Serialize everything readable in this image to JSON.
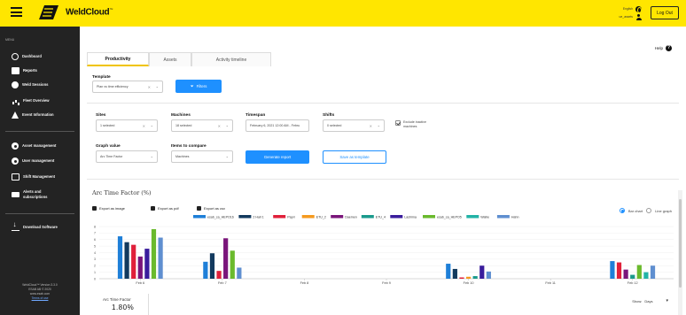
{
  "app": {
    "brand": "WeldCloud",
    "trademark": "™",
    "user_line1": "English",
    "user_line2": "ue_assets",
    "logout_label": "Log Out"
  },
  "sidebar": {
    "menu_label": "MENU",
    "items": [
      {
        "label": "Dashboard",
        "icon": "clock-icon"
      },
      {
        "label": "Reports",
        "icon": "reports-icon",
        "active": true
      },
      {
        "label": "Weld Sessions",
        "icon": "weld-sessions-icon"
      },
      {
        "label": "Fleet Overview",
        "icon": "fleet-overview-icon"
      },
      {
        "label": "Event Information",
        "icon": "warning-icon"
      },
      {
        "label": "Asset management",
        "icon": "asset-icon"
      },
      {
        "label": "User management",
        "icon": "user-icon"
      },
      {
        "label": "Shift Management",
        "icon": "shift-icon"
      },
      {
        "label": "Alerts and subscriptions",
        "icon": "alerts-icon"
      },
      {
        "label": "Download Software",
        "icon": "download-icon"
      }
    ],
    "footer_line1": "WeldCloud™ Version 3.3.0",
    "footer_line2": "ESAB AB © 2020",
    "footer_line3": "www.esab.com",
    "footer_link": "Terms of use"
  },
  "main": {
    "help_label": "Help",
    "tabs": [
      {
        "label": "Productivity",
        "active": true
      },
      {
        "label": "Assets"
      },
      {
        "label": "Activity timeline"
      }
    ],
    "template": {
      "label": "Template",
      "value": "Plan vs time efficiency"
    },
    "filters_button": "Filters",
    "sites": {
      "label": "Sites",
      "value": "1 selected"
    },
    "machines": {
      "label": "Machines",
      "value": "18 selected"
    },
    "timespan": {
      "label": "Timespan",
      "value": "February 6, 2021 12:00 AM - Febru"
    },
    "shifts": {
      "label": "Shifts",
      "value": "0 selected"
    },
    "exclude_inactive": "Exclude inactive machines",
    "graph_value": {
      "label": "Graph value",
      "value": "Arc Time Factor"
    },
    "items_compare": {
      "label": "Items to compare",
      "value": "Machines"
    },
    "generate_button": "Generate report",
    "save_button": "Save as template",
    "section_title": "Arc Time Factor (%)",
    "export_image": "Export as image",
    "export_pdf": "Export as pdf",
    "export_csv": "Export as csv",
    "bar_chart_label": "Bar chart",
    "line_graph_label": "Line graph",
    "stat_label": "Arc Time Factor",
    "stat_value": "1.80%",
    "show_label": "Show:",
    "show_value": "Days"
  },
  "chart_data": {
    "type": "bar",
    "title": "Arc Time Factor (%)",
    "categories": [
      "Feb 6",
      "Feb 7",
      "Feb 8",
      "Feb 9",
      "Feb 10",
      "Feb 11",
      "Feb 12"
    ],
    "ylim": [
      0,
      8
    ],
    "yticks": [
      0,
      1,
      2,
      3,
      4,
      5,
      6,
      7,
      8
    ],
    "legend_position": "top",
    "series": [
      {
        "name": "esab_ca_HEPO16",
        "color": "#1e7fd8",
        "values": [
          6.5,
          2.6,
          0,
          0,
          2.3,
          0,
          2.7
        ]
      },
      {
        "name": "2 Hall 1",
        "color": "#123a5e",
        "values": [
          5.6,
          3.9,
          0,
          0,
          1.5,
          0,
          0
        ]
      },
      {
        "name": "Papri",
        "color": "#e0203a",
        "values": [
          5.2,
          1.2,
          0,
          0,
          0.2,
          0,
          2.5
        ]
      },
      {
        "name": "ETU_2",
        "color": "#f59a1f",
        "values": [
          0,
          0,
          0,
          0,
          0.3,
          0,
          0
        ]
      },
      {
        "name": "Daemen",
        "color": "#7a157a",
        "values": [
          3.4,
          6.2,
          0,
          0,
          0,
          0,
          1.4
        ]
      },
      {
        "name": "ETU_4",
        "color": "#1a9a8c",
        "values": [
          0,
          0,
          0,
          0,
          0.4,
          0,
          0.6
        ]
      },
      {
        "name": "Lashima",
        "color": "#3a1d9c",
        "values": [
          4.6,
          0,
          0,
          0,
          2.0,
          0,
          0
        ]
      },
      {
        "name": "esab_ca_HEPO5",
        "color": "#6aba2d",
        "values": [
          7.6,
          4.3,
          0,
          0,
          0,
          0,
          2.1
        ]
      },
      {
        "name": "Wallie",
        "color": "#22b3a6",
        "values": [
          0,
          0,
          0,
          0,
          0,
          0,
          1.0
        ]
      },
      {
        "name": "Hahn",
        "color": "#5f8fd0",
        "values": [
          6.3,
          1.7,
          0,
          0,
          1.1,
          0,
          2.0
        ]
      }
    ]
  }
}
